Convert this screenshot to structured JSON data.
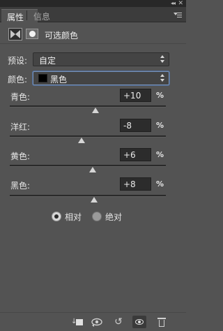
{
  "tabs": [
    {
      "label": "属性",
      "active": true
    },
    {
      "label": "信息",
      "active": false
    }
  ],
  "window_controls": {
    "collapse_glyph": "◂◂",
    "close_glyph": "✕"
  },
  "adjustment": {
    "title": "可选颜色",
    "icon": "selective-color-adjustment-icon",
    "mask_icon": "layer-mask-icon"
  },
  "preset": {
    "label": "预设:",
    "value": "自定"
  },
  "colors": {
    "label": "颜色:",
    "value": "黑色",
    "swatch_color": "#000000"
  },
  "sliders": [
    {
      "label": "青色:",
      "value": "+10",
      "unit": "%",
      "percent": 10
    },
    {
      "label": "洋红:",
      "value": "-8",
      "unit": "%",
      "percent": -8
    },
    {
      "label": "黄色:",
      "value": "+6",
      "unit": "%",
      "percent": 6
    },
    {
      "label": "黑色:",
      "value": "+8",
      "unit": "%",
      "percent": 8
    }
  ],
  "method": {
    "options": [
      {
        "label": "相对",
        "selected": true
      },
      {
        "label": "绝对",
        "selected": false
      }
    ]
  },
  "bottom_toolbar": {
    "icons": [
      "clip-to-layer-icon",
      "view-previous-state-icon",
      "reset-icon",
      "visibility-eye-icon",
      "trash-icon"
    ],
    "reset_glyph": "↺",
    "previous_glyph": "👁"
  },
  "colors_theme": {
    "panel_bg": "#535353",
    "tab_bg": "#3c3c3c",
    "focus_border": "#7892b8"
  }
}
